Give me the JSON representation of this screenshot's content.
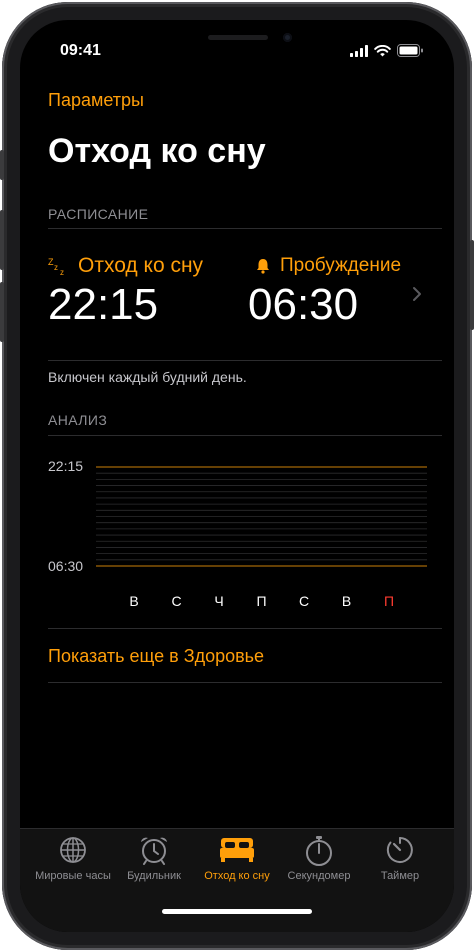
{
  "status": {
    "time": "09:41"
  },
  "nav": {
    "back_label": "Параметры",
    "title": "Отход ко сну"
  },
  "schedule": {
    "section_label": "РАСПИСАНИЕ",
    "bedtime": {
      "label": "Отход ко сну",
      "time": "22:15",
      "icon": "zzz-icon"
    },
    "wake": {
      "label": "Пробуждение",
      "time": "06:30",
      "icon": "bell-icon"
    },
    "note": "Включен каждый будний день."
  },
  "analysis": {
    "section_label": "АНАЛИЗ",
    "top_label": "22:15",
    "bottom_label": "06:30",
    "days": [
      "В",
      "С",
      "Ч",
      "П",
      "С",
      "В",
      "П"
    ],
    "highlight_day_index": 6
  },
  "health_link": "Показать еще в Здоровье",
  "tabs": [
    {
      "label": "Мировые часы",
      "icon": "globe-icon",
      "active": false
    },
    {
      "label": "Будильник",
      "icon": "alarm-clock-icon",
      "active": false
    },
    {
      "label": "Отход ко сну",
      "icon": "bed-icon",
      "active": true
    },
    {
      "label": "Секундомер",
      "icon": "stopwatch-icon",
      "active": false
    },
    {
      "label": "Таймер",
      "icon": "timer-icon",
      "active": false
    }
  ],
  "colors": {
    "accent": "#ff9f0a",
    "background": "#000000",
    "weekend_day": "#ff3b30"
  }
}
